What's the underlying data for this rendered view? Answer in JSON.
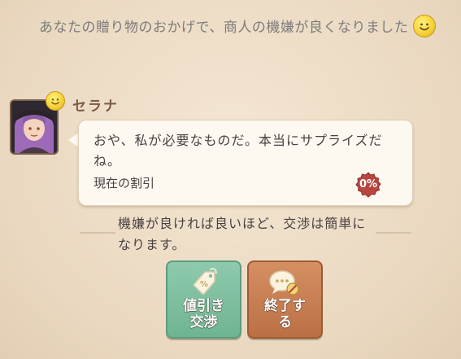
{
  "notice": {
    "text": "あなたの贈り物のおかげで、商人の機嫌が良くなりました",
    "mood_icon": "smiley-face"
  },
  "merchant": {
    "name": "セラナ",
    "mood_icon": "smiley-face",
    "dialog": "おや、私が必要なものだ。本当にサプライズだね。",
    "discount_label": "現在の割引",
    "discount_value": "0%"
  },
  "hint": "機嫌が良ければ良いほど、交渉は簡単になります。",
  "actions": {
    "bargain": {
      "label": "値引き\n交渉",
      "icon": "price-tag-icon"
    },
    "end": {
      "label": "終了す\nる",
      "icon": "speech-bubble-stop-icon"
    }
  },
  "colors": {
    "bargain_button": "#7dbf9f",
    "end_button": "#c87d50",
    "discount_badge": "#b8453f"
  }
}
